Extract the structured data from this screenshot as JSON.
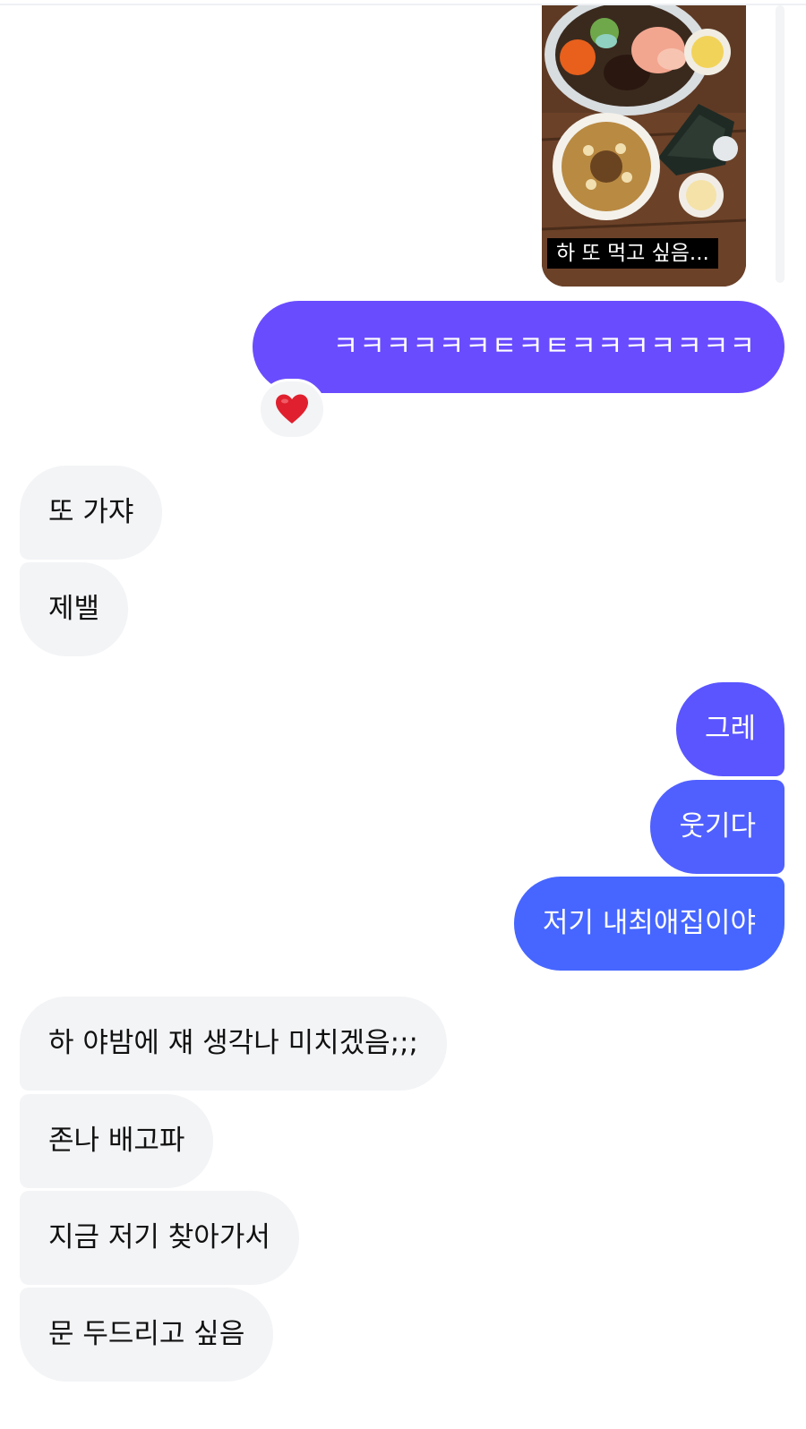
{
  "image_message": {
    "caption": "하 또 먹고 싶음..."
  },
  "messages": [
    {
      "id": "m1",
      "side": "out",
      "text": "ㅋㅋㅋㅋㅋㅋㅌㅋㅌㅋㅋㅋㅋㅋㅋㅋ",
      "reaction": "heart",
      "color": "#6a4cff"
    },
    {
      "id": "m2",
      "side": "in",
      "text": "또 가쟈"
    },
    {
      "id": "m3",
      "side": "in",
      "text": "제밸"
    },
    {
      "id": "m4",
      "side": "out",
      "text": "그레",
      "color": "#5a55ff"
    },
    {
      "id": "m5",
      "side": "out",
      "text": "웃기다",
      "color": "#5060ff"
    },
    {
      "id": "m6",
      "side": "out",
      "text": "저기 내최애집이야",
      "color": "#4666ff"
    },
    {
      "id": "m7",
      "side": "in",
      "text": "하 야밤에 쟤 생각나 미치겠음;;;"
    },
    {
      "id": "m8",
      "side": "in",
      "text": "존나 배고파"
    },
    {
      "id": "m9",
      "side": "in",
      "text": "지금 저기 찾아가서"
    },
    {
      "id": "m10",
      "side": "in",
      "text": "문 두드리고 싶음"
    }
  ],
  "colors": {
    "incoming_bubble": "#f3f4f6",
    "heart": "#e0202e"
  }
}
